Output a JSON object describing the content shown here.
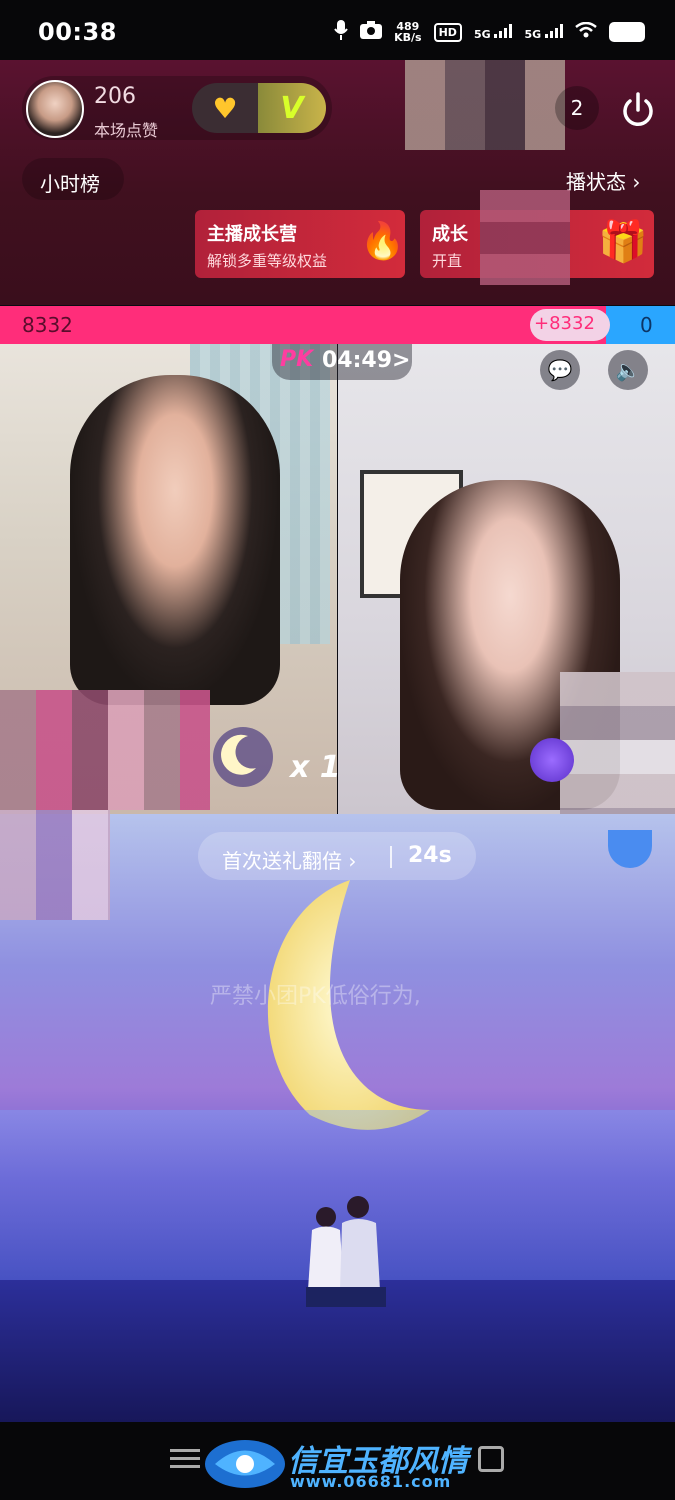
{
  "status_bar": {
    "time": "00:38",
    "network_speed_value": "489",
    "network_speed_unit": "KB/s",
    "signal1": "5G",
    "signal2": "5G"
  },
  "header": {
    "likes_count": "206",
    "likes_label": "本场点赞",
    "vip_label": "V",
    "viewer_count": "2",
    "rank_label": "小时榜",
    "status_link": "播状态 ›",
    "promo_primary": {
      "title": "主播成长营",
      "subtitle": "解锁多重等级权益"
    },
    "promo_secondary": {
      "title": "成长",
      "subtitle": "开直"
    }
  },
  "pk": {
    "score_left": "8332",
    "score_bonus": "+8332",
    "score_right": "0",
    "progress_left_fraction": 1.0,
    "timer": "04:49",
    "timer_arrow": ">",
    "logo": "PK",
    "multiplier": "x 1"
  },
  "gift_event": {
    "banner_text": "首次送礼翻倍 ›",
    "countdown": "24s",
    "notice_text": "严禁小团PK低俗行为,"
  },
  "watermark": {
    "title": "信宜玉都风情",
    "url": "www.06681.com"
  },
  "colors": {
    "score_red": "#ff2d7a",
    "score_blue": "#2aa6ff",
    "promo_red": "#c8283b",
    "vip_gold": "#d8ff2a"
  }
}
